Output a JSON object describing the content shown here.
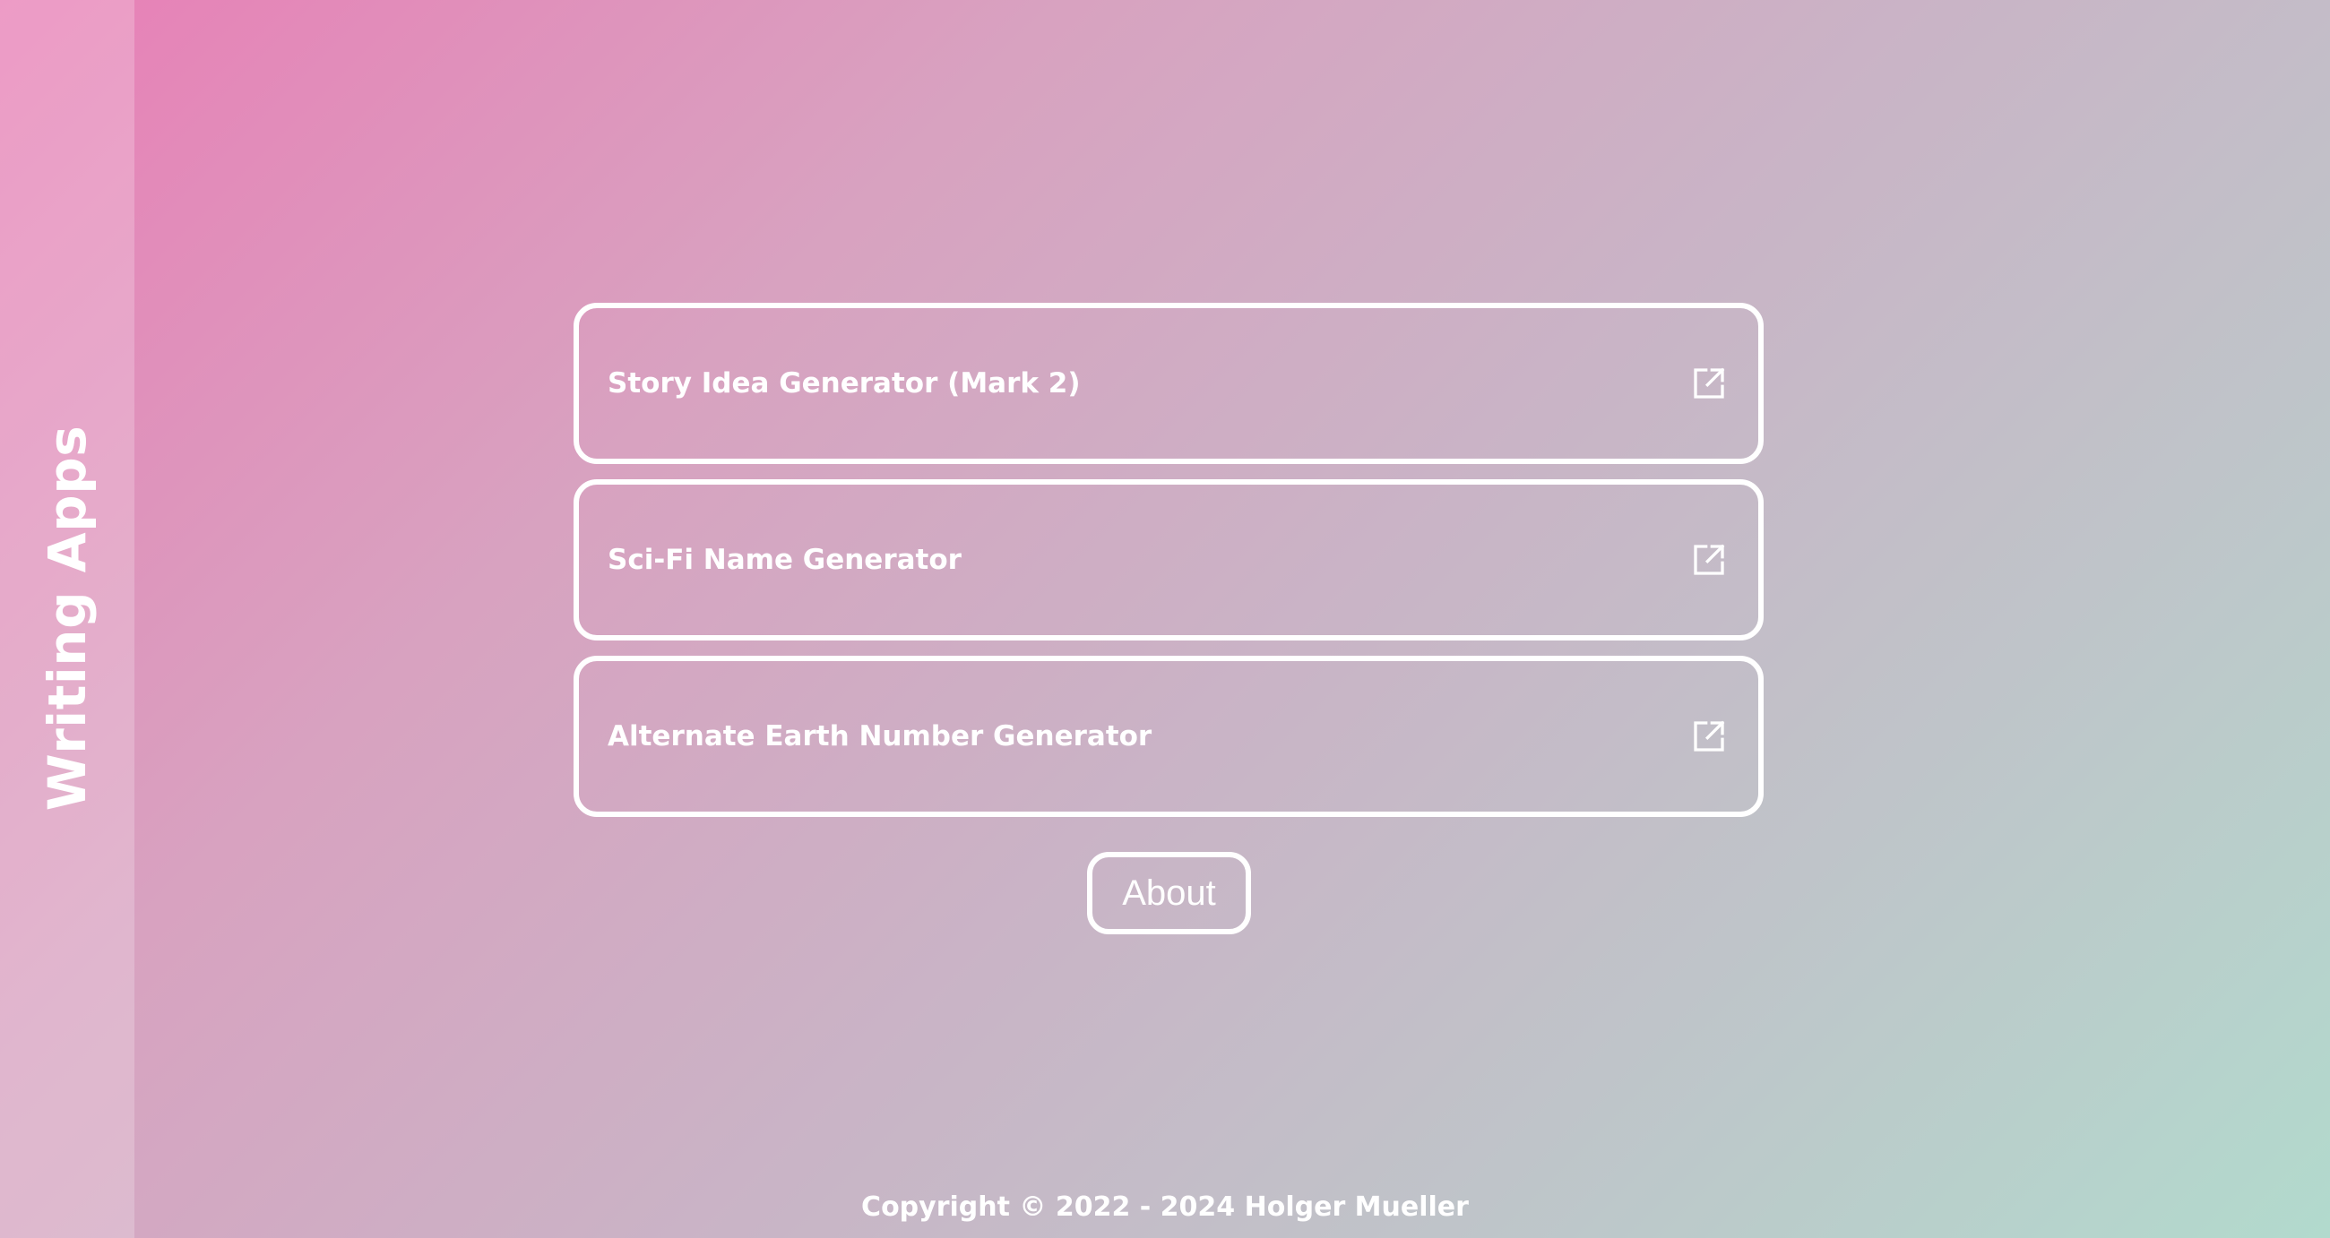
{
  "sidebar": {
    "title": "Writing Apps"
  },
  "apps": [
    {
      "label": "Story Idea Generator (Mark 2)",
      "icon": "external-link-icon"
    },
    {
      "label": "Sci-Fi Name Generator",
      "icon": "external-link-icon"
    },
    {
      "label": "Alternate Earth Number Generator",
      "icon": "external-link-icon"
    }
  ],
  "about": {
    "label": "About"
  },
  "footer": {
    "copyright": "Copyright © 2022 - 2024 Holger Mueller"
  },
  "colors": {
    "gradient_start": "#e87fb6",
    "gradient_end": "#b2dacd",
    "foreground": "#ffffff"
  }
}
